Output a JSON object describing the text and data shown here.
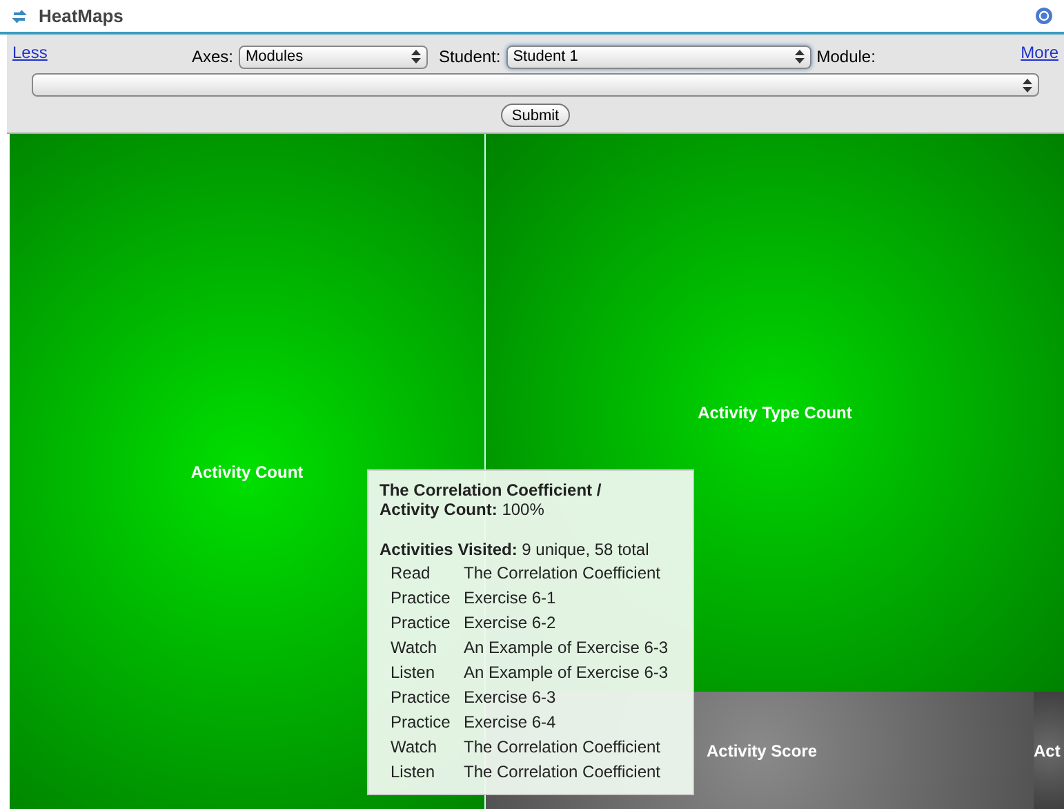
{
  "window": {
    "title": "HeatMaps"
  },
  "toolbar": {
    "less_link": "Less",
    "more_link": "More",
    "axes": {
      "label": "Axes:",
      "value": "Modules"
    },
    "student": {
      "label": "Student:",
      "value": "Student 1"
    },
    "module": {
      "label": "Module:"
    },
    "submit": "Submit"
  },
  "tiles": [
    {
      "label": "Activity Count",
      "color": "#00e000"
    },
    {
      "label": "Activity Type Count",
      "color": "#00d800"
    },
    {
      "label": "Activity Score",
      "color": "#8a8a8a"
    },
    {
      "label": "Act",
      "color": "#6a6a6a"
    }
  ],
  "tooltip": {
    "title": "The Correlation Coefficient /",
    "metric_label": "Activity Count:",
    "metric_value": "100%",
    "visited_label": "Activities Visited:",
    "visited_value": "9 unique, 58 total",
    "rows": [
      {
        "type": "Read",
        "name": "The Correlation Coefficient"
      },
      {
        "type": "Practice",
        "name": "Exercise 6-1"
      },
      {
        "type": "Practice",
        "name": "Exercise 6-2"
      },
      {
        "type": "Watch",
        "name": "An Example of Exercise 6-3"
      },
      {
        "type": "Listen",
        "name": "An Example of Exercise 6-3"
      },
      {
        "type": "Practice",
        "name": "Exercise 6-3"
      },
      {
        "type": "Practice",
        "name": "Exercise 6-4"
      },
      {
        "type": "Watch",
        "name": "The Correlation Coefficient"
      },
      {
        "type": "Listen",
        "name": "The Correlation Coefficient"
      }
    ]
  }
}
